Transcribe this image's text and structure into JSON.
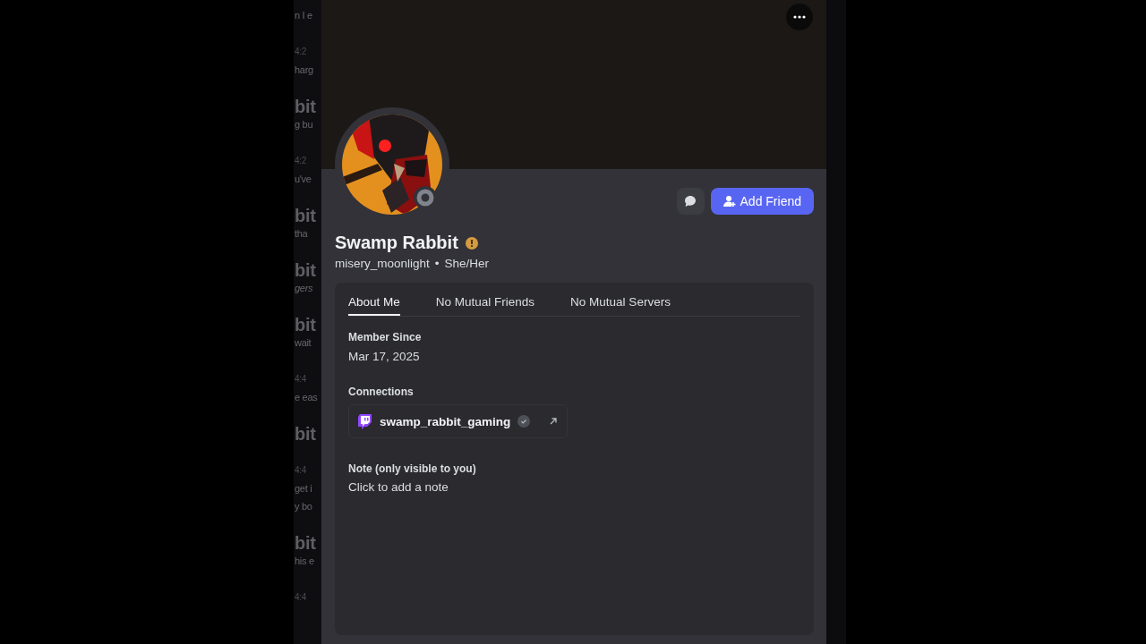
{
  "background_chat": [
    {
      "kind": "text",
      "text": "n I e"
    },
    {
      "kind": "time",
      "text": "4:2"
    },
    {
      "kind": "text",
      "text": "harg"
    },
    {
      "kind": "name",
      "text": "bit"
    },
    {
      "kind": "text",
      "text": "g bu"
    },
    {
      "kind": "time",
      "text": "4:2"
    },
    {
      "kind": "text",
      "text": "u've"
    },
    {
      "kind": "name",
      "text": "bit"
    },
    {
      "kind": "text",
      "text": "tha"
    },
    {
      "kind": "name",
      "text": "bit"
    },
    {
      "kind": "italic",
      "text": "gers"
    },
    {
      "kind": "name",
      "text": "bit"
    },
    {
      "kind": "text",
      "text": "wait"
    },
    {
      "kind": "time",
      "text": "4:4"
    },
    {
      "kind": "text",
      "text": "e eas"
    },
    {
      "kind": "name",
      "text": "bit"
    },
    {
      "kind": "time",
      "text": "4:4"
    },
    {
      "kind": "text",
      "text": "get i"
    },
    {
      "kind": "text",
      "text": "y bo"
    },
    {
      "kind": "name",
      "text": "bit"
    },
    {
      "kind": "text",
      "text": "his e"
    },
    {
      "kind": "time",
      "text": "4:4"
    }
  ],
  "profile": {
    "display_name": "Swamp Rabbit",
    "username": "misery_moonlight",
    "separator": "•",
    "pronouns": "She/Her",
    "add_friend": "Add Friend",
    "tabs": [
      {
        "label": "About Me",
        "selected": true
      },
      {
        "label": "No Mutual Friends",
        "selected": false
      },
      {
        "label": "No Mutual Servers",
        "selected": false
      }
    ],
    "member_since": {
      "label": "Member Since",
      "value": "Mar 17, 2025"
    },
    "connections": {
      "label": "Connections",
      "items": [
        {
          "name": "swamp_rabbit_gaming",
          "verified": true
        }
      ]
    },
    "note": {
      "label": "Note (only visible to you)",
      "placeholder": "Click to add a note"
    }
  }
}
